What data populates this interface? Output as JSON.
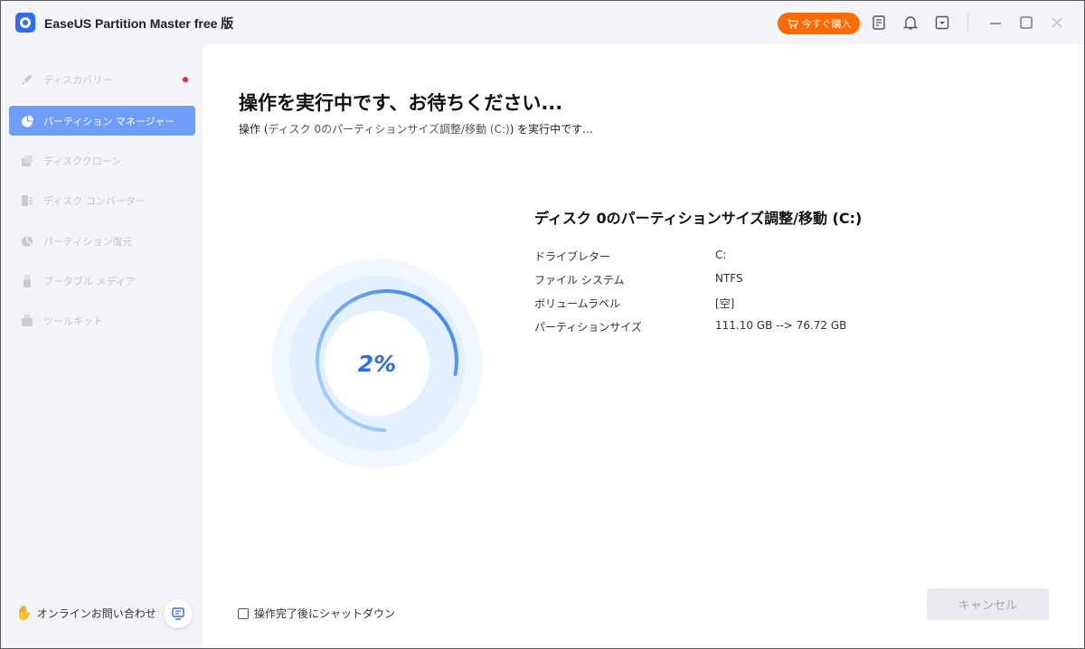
{
  "app": {
    "title": "EaseUS Partition Master free 版",
    "buy_label": "今すぐ購入"
  },
  "titlebar_icons": [
    "notes-icon",
    "bell-icon",
    "dropdown-menu-icon",
    "minimize-icon",
    "maximize-icon",
    "close-icon"
  ],
  "sidebar": {
    "items": [
      {
        "label": "ディスカバリー",
        "icon": "rocket-icon",
        "active": false,
        "badge": true
      },
      {
        "label": "パーティション マネージャー",
        "icon": "pie-icon",
        "active": true,
        "badge": false
      },
      {
        "label": "ディスククローン",
        "icon": "clone-icon",
        "active": false,
        "badge": false
      },
      {
        "label": "ディスク コンバーター",
        "icon": "converter-icon",
        "active": false,
        "badge": false
      },
      {
        "label": "パーティション復元",
        "icon": "recovery-icon",
        "active": false,
        "badge": false
      },
      {
        "label": "ブータブル メディア",
        "icon": "usb-icon",
        "active": false,
        "badge": false
      },
      {
        "label": "ツールキット",
        "icon": "toolkit-icon",
        "active": false,
        "badge": false
      }
    ],
    "support_label": "オンラインお問い合わせ"
  },
  "main": {
    "title": "操作を実行中です、お待ちください...",
    "subtitle_prefix": "操作 (",
    "subtitle_op": "ディスク 0のパーティションサイズ調整/移動 (C:)",
    "subtitle_suffix": ") を実行中です...",
    "progress_text": "2%",
    "progress_value": 0.02,
    "detail_title": "ディスク 0のパーティションサイズ調整/移動 (C:)",
    "details": [
      {
        "key": "ドライブレター",
        "value": "C:"
      },
      {
        "key": "ファイル システム",
        "value": "NTFS"
      },
      {
        "key": "ボリュームラベル",
        "value": "[空]"
      },
      {
        "key": "パーティションサイズ",
        "value": "111.10 GB --> 76.72 GB"
      }
    ],
    "shutdown_label": "操作完了後にシャットダウン",
    "cancel_label": "キャンセル"
  },
  "colors": {
    "accent": "#2d6df6",
    "buy": "#ff6a00",
    "active_nav": "#6f9ef8"
  }
}
